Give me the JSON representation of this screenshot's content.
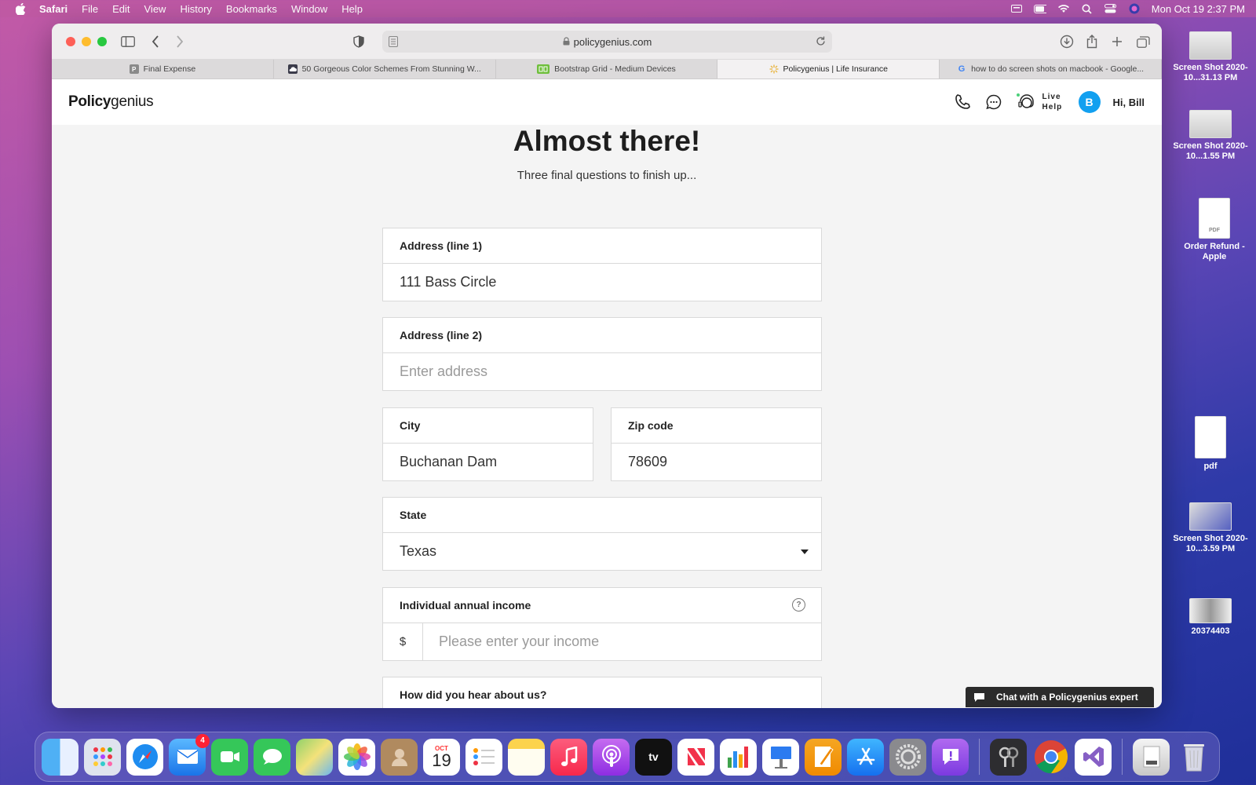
{
  "menubar": {
    "app_name": "Safari",
    "items": [
      "File",
      "Edit",
      "View",
      "History",
      "Bookmarks",
      "Window",
      "Help"
    ],
    "datetime": "Mon Oct 19  2:37 PM"
  },
  "browser": {
    "url": "policygenius.com",
    "tabs": [
      {
        "label": "Final Expense",
        "favicon": "P"
      },
      {
        "label": "50 Gorgeous Color Schemes From Stunning W...",
        "favicon": ""
      },
      {
        "label": "Bootstrap Grid - Medium Devices",
        "favicon": ""
      },
      {
        "label": "Policygenius | Life Insurance",
        "favicon": ""
      },
      {
        "label": "how to do screen shots on macbook - Google...",
        "favicon": "G"
      }
    ],
    "active_tab": 3
  },
  "site": {
    "logo_bold": "Policy",
    "logo_light": "genius",
    "live_help_line1": "Live",
    "live_help_line2": "Help",
    "avatar_initial": "B",
    "greeting": "Hi, Bill"
  },
  "form": {
    "heading": "Almost there!",
    "subheading": "Three final questions to finish up...",
    "address1": {
      "label": "Address (line 1)",
      "value": "111 Bass Circle"
    },
    "address2": {
      "label": "Address (line 2)",
      "placeholder": "Enter address"
    },
    "city": {
      "label": "City",
      "value": "Buchanan Dam"
    },
    "zip": {
      "label": "Zip code",
      "value": "78609"
    },
    "state": {
      "label": "State",
      "value": "Texas"
    },
    "income": {
      "label": "Individual annual income",
      "prefix": "$",
      "placeholder": "Please enter your income",
      "help": "?"
    },
    "referral": {
      "label": "How did you hear about us?"
    }
  },
  "chat": {
    "label": "Chat with a Policygenius expert"
  },
  "desktop": {
    "items": [
      {
        "name": "Screen Shot 2020-10...31.13 PM"
      },
      {
        "name": "Screen Shot 2020-10...1.55 PM"
      },
      {
        "name": "Order Refund - Apple",
        "thumb_label": "PDF"
      },
      {
        "name": "pdf"
      },
      {
        "name": "Screen Shot 2020-10...3.59 PM"
      },
      {
        "name": "20374403"
      }
    ]
  },
  "dock": {
    "mail_badge": "4",
    "calendar_month": "OCT",
    "calendar_day": "19",
    "tv_label": "tv"
  },
  "colors": {
    "accent_blue": "#12a0f0",
    "chat_bg": "#2b2b2b"
  }
}
